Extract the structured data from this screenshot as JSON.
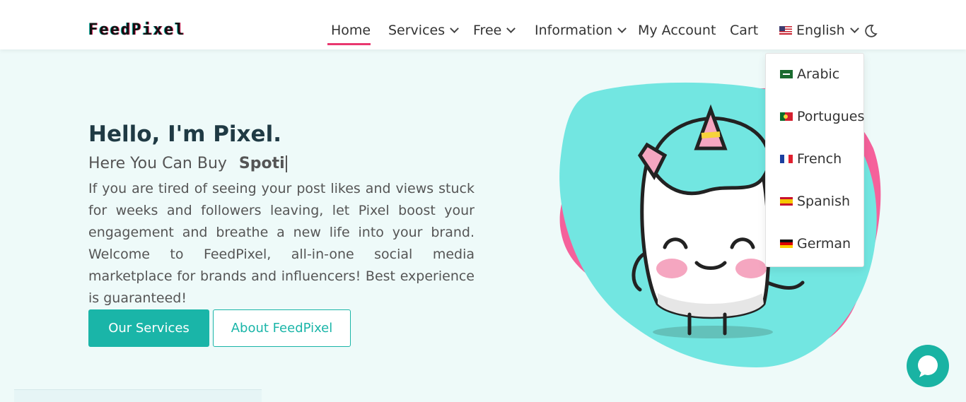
{
  "brand": {
    "logo_text": "FeedPixel",
    "accent": "#e9386f",
    "primary": "#1ab5a8"
  },
  "nav": {
    "home": "Home",
    "services": "Services",
    "free": "Free",
    "information": "Information",
    "my_account": "My Account",
    "cart": "Cart",
    "language": "English"
  },
  "language_menu": {
    "items": [
      {
        "label": "Arabic",
        "flag": "sa-flag"
      },
      {
        "label": "Portugues",
        "flag": "pt-flag"
      },
      {
        "label": "French",
        "flag": "fr-flag"
      },
      {
        "label": "Spanish",
        "flag": "es-flag"
      },
      {
        "label": "German",
        "flag": "de-flag"
      }
    ]
  },
  "hero": {
    "title": "Hello, I'm Pixel.",
    "subtitle_prefix": "Here You Can Buy",
    "subtitle_typed": "Spoti",
    "description": "If you are tired of seeing your post likes and views stuck for weeks and followers leaving, let Pixel boost your engagement and breathe a new life into your brand. Welcome to FeedPixel, all-in-one social media marketplace for brands and influencers! Best experience is guaranteed!",
    "primary_button": "Our Services",
    "secondary_button": "About FeedPixel"
  },
  "icons": {
    "theme_toggle": "moon-icon",
    "chat": "chat-bubble-icon",
    "mascot": "unicorn-mascot-illustration"
  }
}
